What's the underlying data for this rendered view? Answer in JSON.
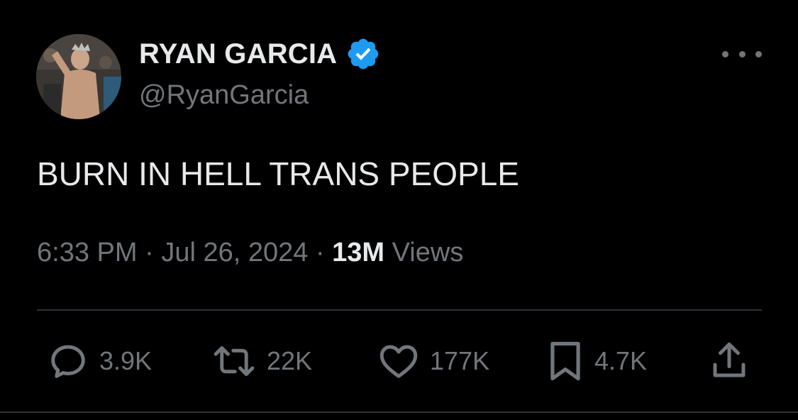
{
  "user": {
    "display_name": "RYAN GARCIA",
    "handle": "@RyanGarcia",
    "verified": true
  },
  "tweet": {
    "text": "BURN IN HELL TRANS PEOPLE",
    "time": "6:33 PM",
    "date": "Jul 26, 2024",
    "separator": "·",
    "views_count": "13M",
    "views_label": "Views"
  },
  "actions": {
    "replies": "3.9K",
    "reposts": "22K",
    "likes": "177K",
    "bookmarks": "4.7K"
  },
  "icons": {
    "more": "more-horizontal-icon",
    "reply": "reply-icon",
    "repost": "repost-icon",
    "like": "heart-icon",
    "bookmark": "bookmark-icon",
    "share": "share-icon",
    "verified": "verified-badge-icon"
  },
  "colors": {
    "background": "#000000",
    "text_primary": "#e7e9ea",
    "text_secondary": "#71767b",
    "verified_blue": "#1d9bf0",
    "divider": "#2f3336"
  }
}
